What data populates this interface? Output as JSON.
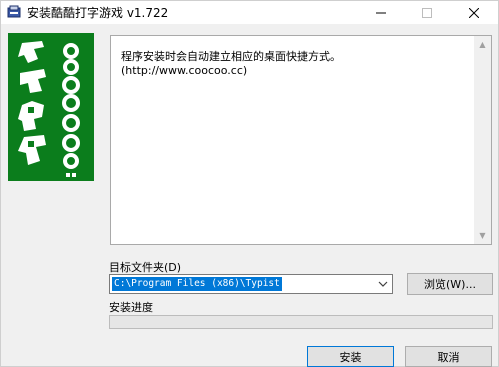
{
  "window": {
    "title": "安装酷酷打字游戏 v1.722",
    "icon": "installer-icon"
  },
  "titlebar_controls": {
    "minimize": "—",
    "maximize": "☐",
    "close": "✕"
  },
  "logo": {
    "alt_text": "coocoo.cc 酷酷"
  },
  "info": {
    "line1": "程序安装时会自动建立相应的桌面快捷方式。",
    "line2": "(http://www.coocoo.cc)"
  },
  "install_folder": {
    "label": "目标文件夹(D)",
    "value": "C:\\Program Files (x86)\\Typist"
  },
  "buttons": {
    "browse": "浏览(W)...",
    "install": "安装",
    "cancel": "取消"
  },
  "progress": {
    "label": "安装进度",
    "value": 0
  },
  "colors": {
    "logo_bg": "#0b7d1c",
    "selection": "#0078d7",
    "window_bg": "#f0f0f0"
  }
}
